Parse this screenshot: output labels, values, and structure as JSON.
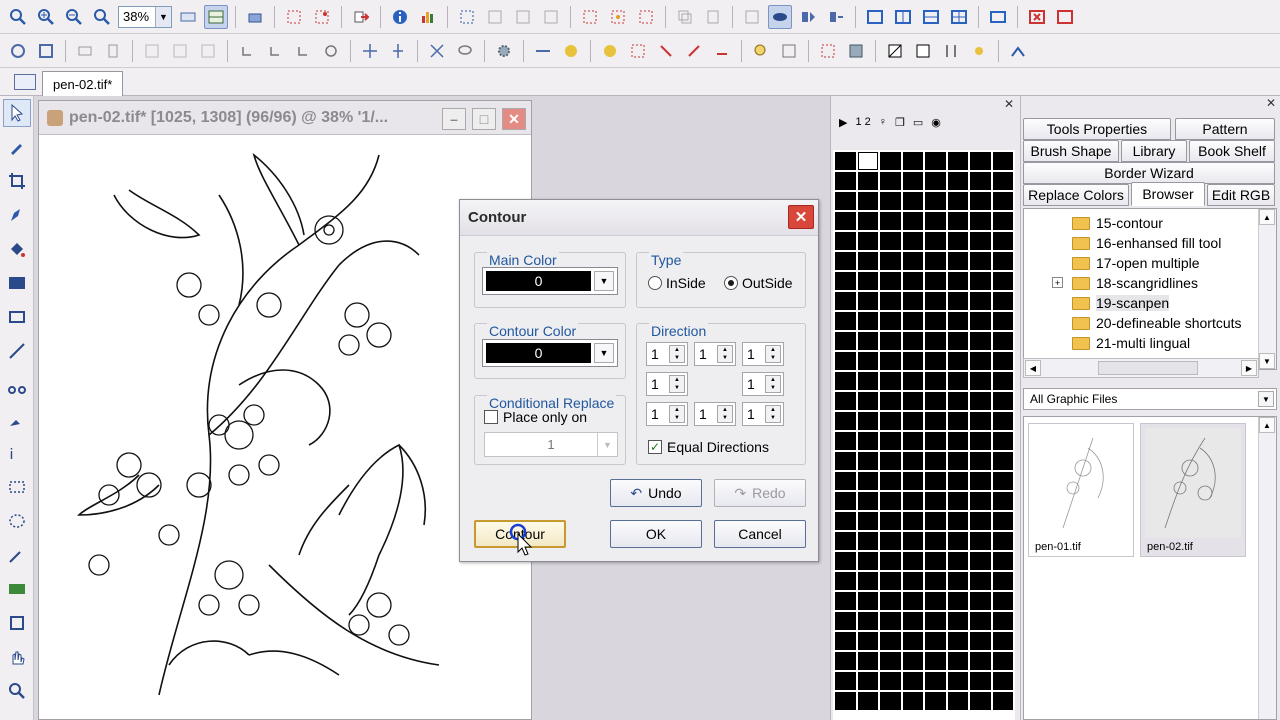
{
  "toolbar": {
    "zoom_value": "38%"
  },
  "tabbar": {
    "doc_tab": "pen-02.tif*"
  },
  "image_window": {
    "title": "pen-02.tif* [1025, 1308] (96/96)  @ 38% '1/..."
  },
  "dialog": {
    "title": "Contour",
    "main_color": {
      "label": "Main Color",
      "value": "0"
    },
    "contour_color": {
      "label": "Contour Color",
      "value": "0"
    },
    "conditional": {
      "label": "Conditional Replace",
      "place_only_on": "Place only on",
      "value": "1"
    },
    "type": {
      "label": "Type",
      "inside": "InSide",
      "outside": "OutSide",
      "selected": "OutSide"
    },
    "direction": {
      "label": "Direction",
      "values": [
        "1",
        "1",
        "1",
        "1",
        "1",
        "1",
        "1",
        "1"
      ],
      "equal_directions": "Equal Directions"
    },
    "buttons": {
      "undo": "Undo",
      "redo": "Redo",
      "contour": "Contour",
      "ok": "OK",
      "cancel": "Cancel"
    }
  },
  "right_panel": {
    "tabs": [
      "Tools Properties",
      "Pattern",
      "Brush Shape",
      "Library",
      "Book Shelf",
      "Border Wizard",
      "Replace Colors",
      "Browser",
      "Edit RGB"
    ],
    "selected_tab": "Browser",
    "tree": [
      "15-contour",
      "16-enhansed fill tool",
      "17-open multiple",
      "18-scangridlines",
      "19-scanpen",
      "20-defineable shortcuts",
      "21-multi lingual"
    ],
    "selected_folder": "19-scanpen",
    "filter": "All Graphic Files",
    "thumbnails": [
      "pen-01.tif",
      "pen-02.tif"
    ]
  },
  "palette_panel": {
    "header_label": "1 2"
  }
}
